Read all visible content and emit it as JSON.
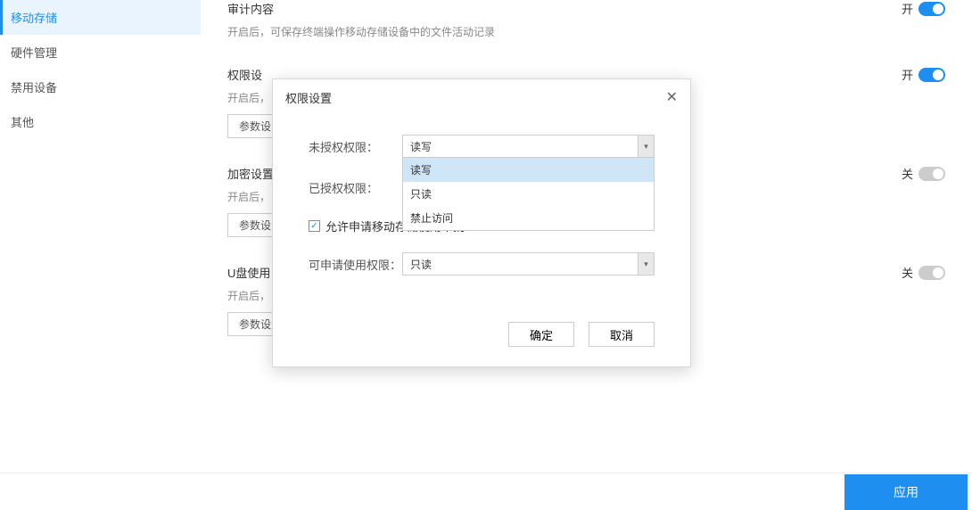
{
  "sidebar": {
    "items": [
      {
        "label": "移动存储",
        "active": true
      },
      {
        "label": "硬件管理",
        "active": false
      },
      {
        "label": "禁用设备",
        "active": false
      },
      {
        "label": "其他",
        "active": false
      }
    ]
  },
  "sections": {
    "audit": {
      "title": "审计内容",
      "desc": "开启后，可保存终端操作移动存储设备中的文件活动记录",
      "toggle_label": "开",
      "toggle_on": true
    },
    "permission": {
      "title": "权限设",
      "desc": "开启后，",
      "toggle_label": "开",
      "toggle_on": true,
      "param_btn": "参数设"
    },
    "encrypt": {
      "title": "加密设置",
      "desc": "开启后，",
      "toggle_label": "关",
      "toggle_on": false,
      "param_btn": "参数设"
    },
    "usb": {
      "title": "U盘使用",
      "desc": "开启后，",
      "toggle_label": "关",
      "toggle_on": false,
      "param_btn": "参数设置"
    }
  },
  "modal": {
    "title": "权限设置",
    "unauth_label": "未授权权限：",
    "auth_label": "已授权权限：",
    "select_value": "读写",
    "dropdown_options": [
      "读写",
      "只读",
      "禁止访问"
    ],
    "checkbox_label": "允许申请移动存储使用审批",
    "checkbox_checked": true,
    "apply_perm_label": "可申请使用权限：",
    "apply_perm_value": "只读",
    "ok": "确定",
    "cancel": "取消"
  },
  "footer": {
    "apply": "应用"
  }
}
